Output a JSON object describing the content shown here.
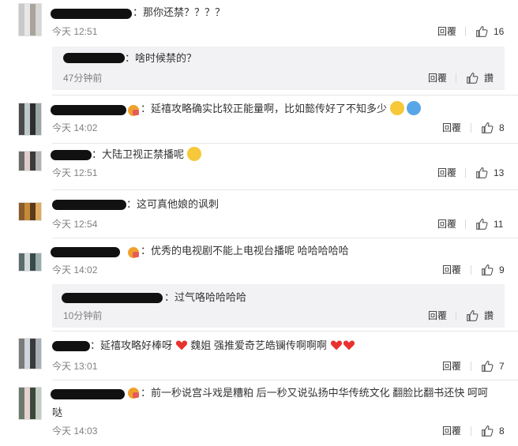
{
  "actions": {
    "reply": "回覆",
    "like": "讚"
  },
  "comments": [
    {
      "text": "：那你还禁？？？？",
      "time": "今天 12:51",
      "likes": "16"
    },
    {
      "text": "：啥时候禁的？",
      "time": "47分钟前"
    },
    {
      "text": "：延禧攻略确实比较正能量啊，比如懿传好了不知多少",
      "time": "今天 14:02",
      "likes": "8"
    },
    {
      "text": "：大陆卫视正禁播呢",
      "time": "今天 12:51",
      "likes": "13"
    },
    {
      "text": "：这可真他娘的讽刺",
      "time": "今天 12:54",
      "likes": "11"
    },
    {
      "text": "：优秀的电视剧不能上电视台播呢 哈哈哈哈哈",
      "time": "今天 14:02",
      "likes": "9"
    },
    {
      "text": "：过气咯哈哈哈哈",
      "time": "10分钟前"
    },
    {
      "text": "：延禧攻略好棒呀",
      "text2": "魏姐 强推爱奇艺皓镧传啊啊啊",
      "time": "今天 13:01",
      "likes": "7"
    },
    {
      "text": "：前一秒说宫斗戏是糟粕 后一秒又说弘扬中华传统文化 翻脸比翻书还快 呵呵",
      "text_line2": "哒",
      "time": "今天 14:03",
      "likes": "8"
    }
  ]
}
